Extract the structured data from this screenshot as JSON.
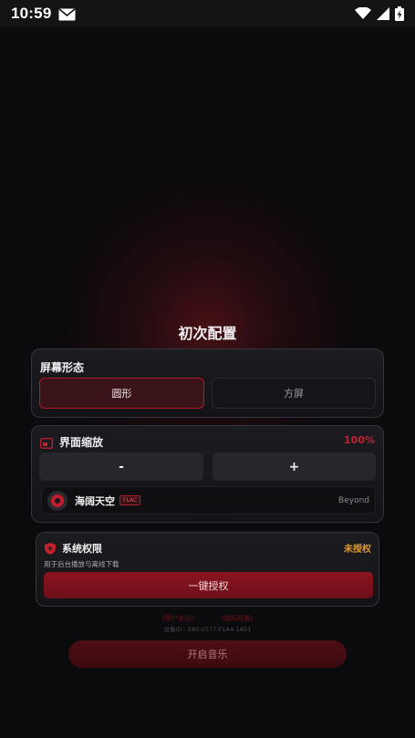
{
  "status_bar": {
    "time": "10:59",
    "icons": [
      "mail-icon",
      "wifi-icon",
      "signal-icon",
      "battery-charging-icon"
    ]
  },
  "page": {
    "title": "初次配置"
  },
  "screen_shape": {
    "title": "屏幕形态",
    "options": [
      "圆形",
      "方屏"
    ],
    "selected": "圆形"
  },
  "ui_scale": {
    "icon": "screen-scale-icon",
    "title": "界面缩放",
    "percent": "100%",
    "decrease_label": "-",
    "increase_label": "+",
    "preview": {
      "song": "海阔天空",
      "badge": "FLAC",
      "artist": "Beyond"
    }
  },
  "permission": {
    "icon": "shield-icon",
    "title": "系统权限",
    "status": "未授权",
    "description": "用于后台播放与离线下载",
    "button_label": "一键授权"
  },
  "footer": {
    "user_agreement": "《用户协议》",
    "separator": "·",
    "privacy_policy": "《隐私政策》",
    "device_id": "设备ID：E80-0177-F1A4-1A51"
  },
  "start_button": {
    "label": "开启音乐"
  },
  "colors": {
    "accent": "#c4202e",
    "warning": "#e09a2a",
    "background": "#0b0b0d"
  }
}
